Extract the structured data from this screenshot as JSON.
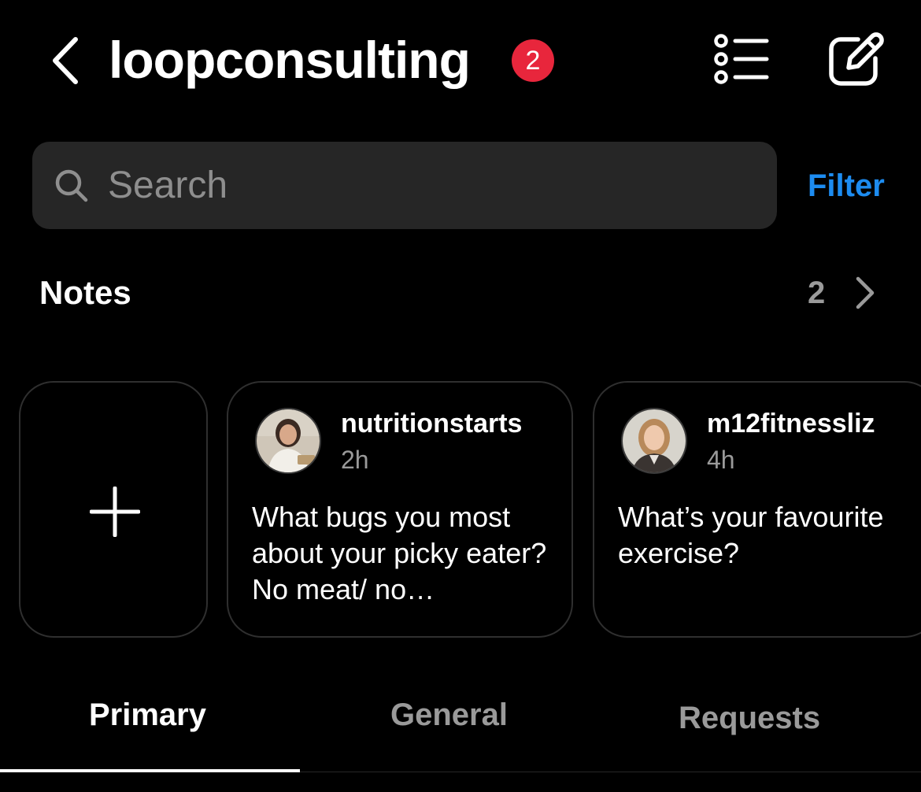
{
  "header": {
    "account_name": "loopconsulting",
    "unread_badge": "2",
    "icons": {
      "back": "chevron-left-icon",
      "list": "list-icon",
      "compose": "compose-icon"
    }
  },
  "search": {
    "placeholder": "Search",
    "value": "",
    "icon": "search-icon",
    "filter_label": "Filter"
  },
  "notes": {
    "heading": "Notes",
    "count": "2",
    "items": [
      {
        "username": "nutritionstarts",
        "time": "2h",
        "text": "What bugs you most about your picky eater? No meat/ no…"
      },
      {
        "username": "m12fitnessliz",
        "time": "4h",
        "text": "What’s your favourite exercise?"
      }
    ]
  },
  "tabs": [
    {
      "label": "Primary",
      "active": true
    },
    {
      "label": "General",
      "active": false
    },
    {
      "label": "Requests",
      "active": false
    }
  ],
  "colors": {
    "background": "#000000",
    "accent": "#1d8cf0",
    "badge": "#e8263c",
    "search_bg": "#262626",
    "muted_text": "#9a9a9a"
  }
}
